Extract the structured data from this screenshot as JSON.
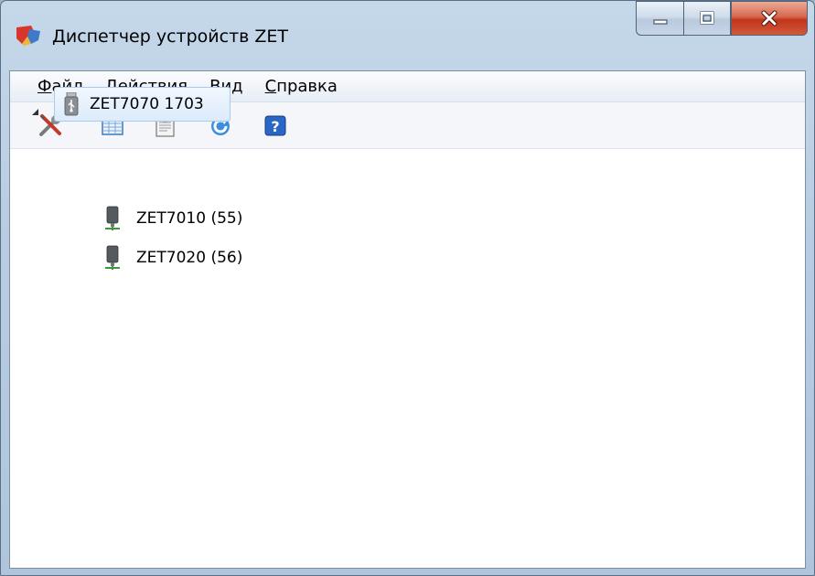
{
  "window": {
    "title": "Диспетчер устройств ZET",
    "accent": "#c2351b"
  },
  "menu": {
    "items": [
      {
        "first": "Ф",
        "rest": "айл"
      },
      {
        "first": "Д",
        "rest": "ействия"
      },
      {
        "first": "В",
        "rest": "ид"
      },
      {
        "first": "С",
        "rest": "правка"
      }
    ]
  },
  "toolbar": {
    "buttons": [
      "properties-tools-icon",
      "table-view-icon",
      "clipboard-icon",
      "refresh-icon",
      "help-icon"
    ]
  },
  "tree": {
    "root": {
      "label": "ZET7070 1703",
      "icon": "usb-device-icon",
      "expanded": true
    },
    "children": [
      {
        "label": "ZET7010 (55)",
        "icon": "sensor-device-icon"
      },
      {
        "label": "ZET7020 (56)",
        "icon": "sensor-device-icon"
      }
    ]
  }
}
